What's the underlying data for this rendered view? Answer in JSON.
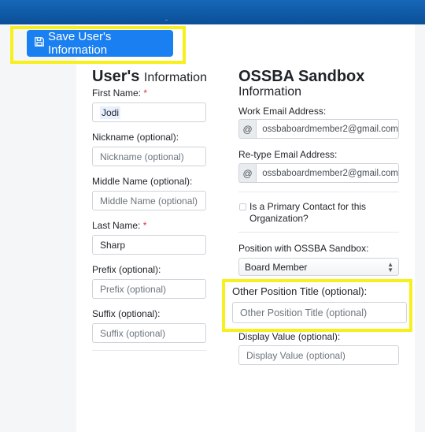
{
  "toolbar": {
    "save_label": "Save User's Information"
  },
  "user_section": {
    "title_big": "User's",
    "title_small": "Information",
    "first_name": {
      "label": "First Name:",
      "required": "*",
      "value": "Jodi"
    },
    "nickname": {
      "label": "Nickname (optional):",
      "placeholder": "Nickname (optional)"
    },
    "middle_name": {
      "label": "Middle Name (optional):",
      "placeholder": "Middle Name (optional)"
    },
    "last_name": {
      "label": "Last Name:",
      "required": "*",
      "value": "Sharp"
    },
    "prefix": {
      "label": "Prefix (optional):",
      "placeholder": "Prefix (optional)"
    },
    "suffix": {
      "label": "Suffix (optional):",
      "placeholder": "Suffix (optional)"
    }
  },
  "org_section": {
    "title_big": "OSSBA Sandbox",
    "title_small": "Information",
    "work_email": {
      "label": "Work Email Address:",
      "addon": "@",
      "value": "ossbaboardmember2@gmail.com"
    },
    "retype_email": {
      "label": "Re-type Email Address:",
      "addon": "@",
      "value": "ossbaboardmember2@gmail.com"
    },
    "primary_contact": {
      "label_line1": "Is a Primary Contact for this",
      "label_line2": "Organization?",
      "checked": false
    },
    "position": {
      "label": "Position with OSSBA Sandbox:",
      "selected": "Board Member"
    },
    "other_title": {
      "label": "Other Position Title (optional):",
      "placeholder": "Other Position Title (optional)"
    },
    "display_value": {
      "label": "Display Value (optional):",
      "placeholder": "Display Value (optional)"
    }
  },
  "colors": {
    "header": "#0b4f98",
    "primary_button": "#1a7ff0",
    "highlight": "#f7f01c",
    "required": "#dc3545"
  },
  "icons": {
    "save": "floppy-disk-icon",
    "select": "updown-arrows-icon"
  }
}
